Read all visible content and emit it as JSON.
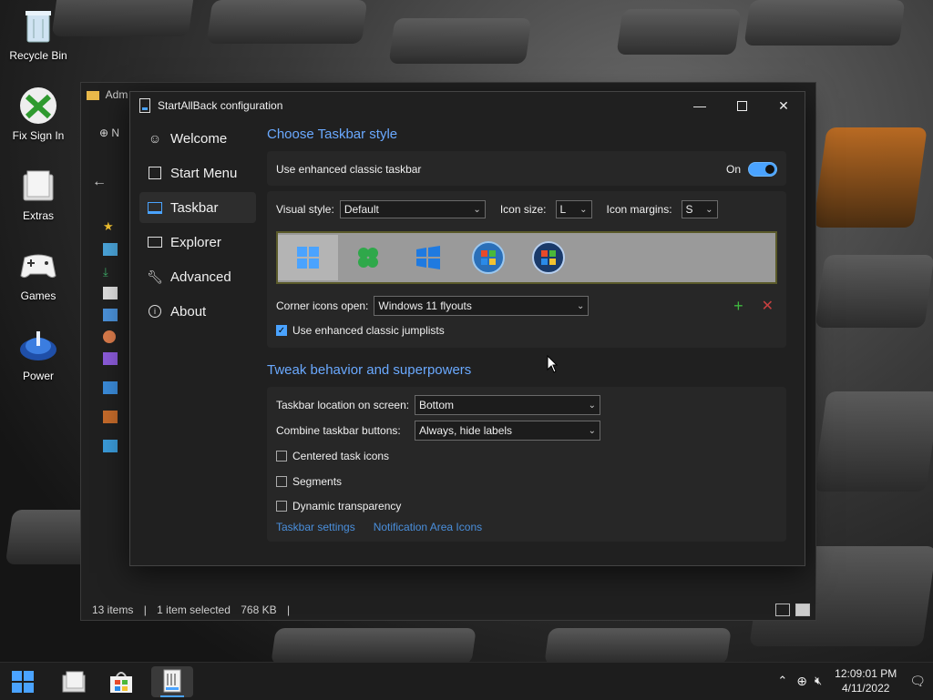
{
  "desktop": {
    "icons": [
      {
        "label": "Recycle Bin",
        "icon": "recycle-bin-icon"
      },
      {
        "label": "Fix Sign In",
        "icon": "xbox-icon"
      },
      {
        "label": "Extras",
        "icon": "folder-icon"
      },
      {
        "label": "Games",
        "icon": "gamepad-icon"
      },
      {
        "label": "Power",
        "icon": "power-icon"
      }
    ]
  },
  "explorer": {
    "tab_label": "Adm",
    "new_label": "N",
    "status": {
      "items": "13 items",
      "selected": "1 item selected",
      "size": "768 KB"
    }
  },
  "dialog": {
    "title": "StartAllBack configuration",
    "nav": [
      {
        "label": "Welcome",
        "icon": "smiley-icon"
      },
      {
        "label": "Start Menu",
        "icon": "start-menu-icon"
      },
      {
        "label": "Taskbar",
        "icon": "taskbar-icon",
        "active": true
      },
      {
        "label": "Explorer",
        "icon": "folder-outline-icon"
      },
      {
        "label": "Advanced",
        "icon": "wrench-icon"
      },
      {
        "label": "About",
        "icon": "info-icon"
      }
    ],
    "taskbar_style": {
      "heading": "Choose Taskbar style",
      "enhanced_label": "Use enhanced classic taskbar",
      "enhanced_state": "On",
      "visual_style_label": "Visual style:",
      "visual_style_value": "Default",
      "icon_size_label": "Icon size:",
      "icon_size_value": "L",
      "icon_margins_label": "Icon margins:",
      "icon_margins_value": "S",
      "corner_icons_label": "Corner icons open:",
      "corner_icons_value": "Windows 11 flyouts",
      "jumplists_label": "Use enhanced classic jumplists"
    },
    "tweak": {
      "heading": "Tweak behavior and superpowers",
      "location_label": "Taskbar location on screen:",
      "location_value": "Bottom",
      "combine_label": "Combine taskbar buttons:",
      "combine_value": "Always, hide labels",
      "centered_label": "Centered task icons",
      "segments_label": "Segments",
      "dynamic_label": "Dynamic transparency",
      "link_settings": "Taskbar settings",
      "link_notification": "Notification Area Icons"
    }
  },
  "taskbar": {
    "time": "12:09:01 PM",
    "date": "4/11/2022"
  },
  "colors": {
    "accent": "#4aa3ff",
    "heading": "#6aa9ff",
    "link": "#4a8fdc"
  }
}
